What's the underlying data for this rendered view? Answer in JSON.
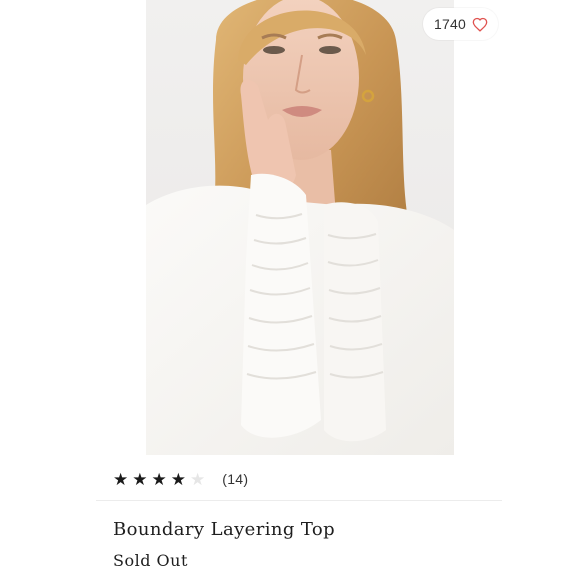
{
  "likes": {
    "count": "1740",
    "icon": "heart-outline-icon",
    "icon_color": "#e0524f"
  },
  "rating": {
    "stars": [
      "★",
      "★",
      "★",
      "★",
      "★"
    ],
    "filled": 4,
    "out_of": 5,
    "review_count": "(14)"
  },
  "product": {
    "title": "Boundary Layering Top",
    "status": "Sold Out"
  },
  "colors": {
    "star_filled": "#1a1a1a",
    "star_empty": "#e6e6e6",
    "photo_background": "#eeeceb"
  }
}
